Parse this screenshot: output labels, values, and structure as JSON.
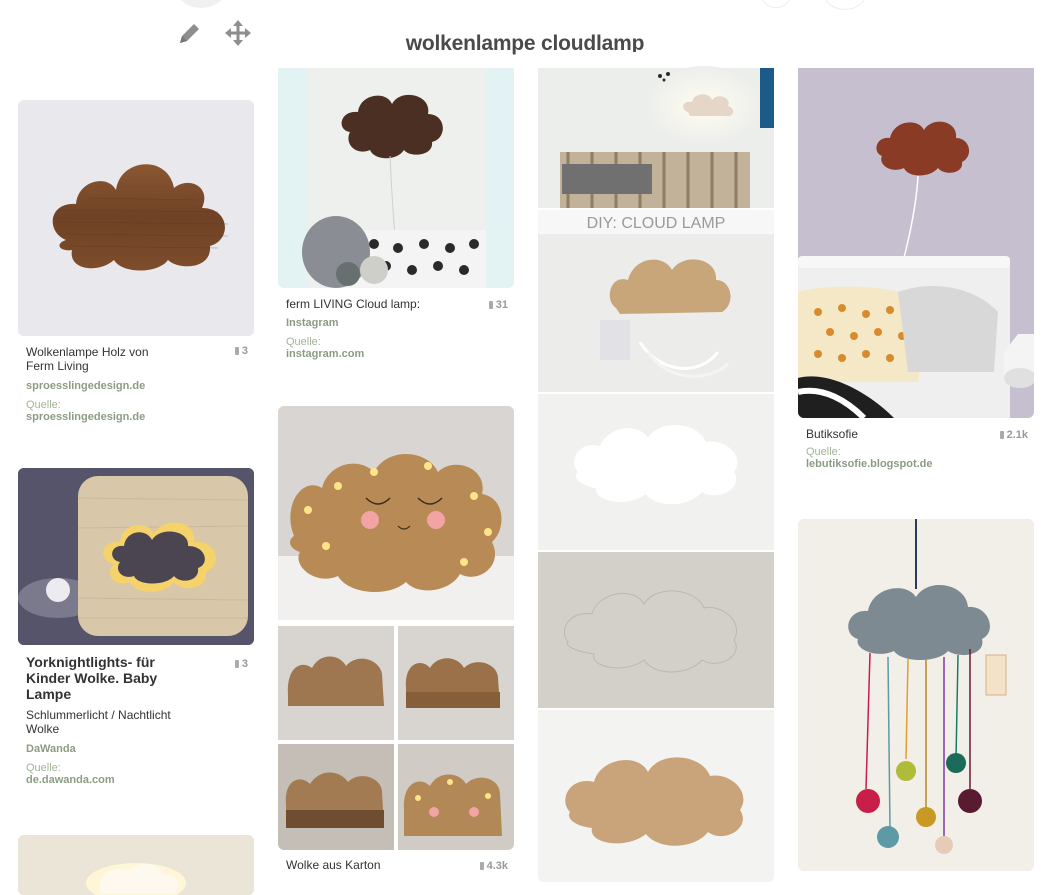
{
  "board": {
    "title": "wolkenlampe cloudlamp",
    "tools": [
      {
        "name": "edit",
        "icon": "pencil-icon"
      },
      {
        "name": "organize",
        "icon": "move-arrows-icon"
      }
    ]
  },
  "pins": [
    {
      "description": "Wolkenlampe Holz von Ferm Living",
      "repins": "3",
      "domain": "sproesslingedesign.de",
      "source_label": "Quelle:",
      "source_url": "sproesslingedesign.de"
    },
    {
      "description": "Yorknightlights- für Kinder Wolke. Baby Lampe",
      "subdescription": "Schlummerlicht / Nachtlicht Wolke",
      "repins": "3",
      "domain": "DaWanda",
      "source_label": "Quelle:",
      "source_url": "de.dawanda.com"
    },
    {
      "description": "ferm LIVING Cloud lamp:",
      "repins": "31",
      "domain": "Instagram",
      "source_label": "Quelle:",
      "source_url": "instagram.com"
    },
    {
      "description": "Wolke aus Karton",
      "repins": "4.3k"
    },
    {
      "overlay_text": "DIY: CLOUD LAMP"
    },
    {
      "description": "Butiksofie",
      "repins": "2.1k",
      "source_label": "Quelle:",
      "source_url": "lebutiksofie.blogspot.de"
    }
  ],
  "colors": {
    "title": "#4a4a4a",
    "source_link": "#8c9c84",
    "repin_count": "#999999",
    "wood": "#7a4a2a"
  }
}
